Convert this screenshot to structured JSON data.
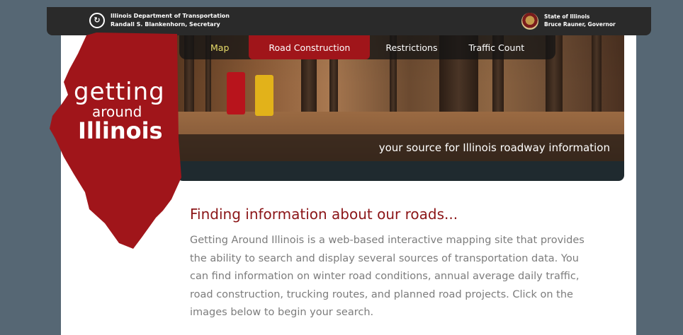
{
  "header": {
    "department": "Illinois Department of Transportation",
    "secretary": "Randall S. Blankenhorn, Secretary",
    "state": "State of Illinois",
    "governor": "Bruce Rauner, Governor"
  },
  "nav": {
    "items": [
      {
        "label": "Map"
      },
      {
        "label": "Road Construction"
      },
      {
        "label": "Restrictions"
      },
      {
        "label": "Traffic Count"
      }
    ]
  },
  "logo": {
    "line1": "getting",
    "line2": "around",
    "line3": "Illinois"
  },
  "hero": {
    "tagline": "your source for Illinois roadway information"
  },
  "content": {
    "title": "Finding information about our roads...",
    "body": "Getting Around Illinois is a web-based interactive mapping site that provides the ability to search and display several sources of transportation data. You can find information on winter road conditions, annual average daily traffic, road construction, trucking routes, and planned road projects. Click on the images below to begin your search."
  },
  "colors": {
    "background": "#566774",
    "brand_red": "#a0151a",
    "title_red": "#8b1517",
    "nav_active": "#a0151a",
    "nav_map": "#e8dc6a"
  },
  "icons": {
    "idot_logo": "idot-logo-icon",
    "state_seal": "state-seal-icon"
  }
}
